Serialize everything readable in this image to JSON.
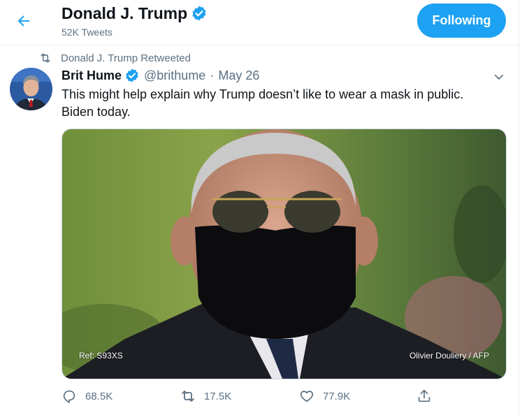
{
  "header": {
    "display_name": "Donald J. Trump",
    "tweet_count": "52K Tweets",
    "follow_label": "Following"
  },
  "retweet_context": {
    "text": "Donald J. Trump Retweeted"
  },
  "tweet": {
    "author_name": "Brit Hume",
    "handle": "@brithume",
    "separator": "·",
    "date": "May 26",
    "text_line1": "This might help explain why Trump doesn’t like to wear a mask in public.",
    "text_line2": "Biden today.",
    "media": {
      "ref_label": "Ref: S93XS",
      "credit": "Olivier Douliery / AFP"
    },
    "actions": {
      "replies": "68.5K",
      "retweets": "17.5K",
      "likes": "77.9K"
    }
  },
  "colors": {
    "accent": "#1da1f2",
    "secondary_text": "#5b7083",
    "primary_text": "#0f1419",
    "border": "#e6ecf0"
  },
  "icons": {
    "back": "arrow-left-icon",
    "verified": "verified-badge-icon",
    "retweet": "retweet-icon",
    "caret": "chevron-down-icon",
    "reply": "reply-icon",
    "like": "heart-icon",
    "share": "share-icon"
  }
}
